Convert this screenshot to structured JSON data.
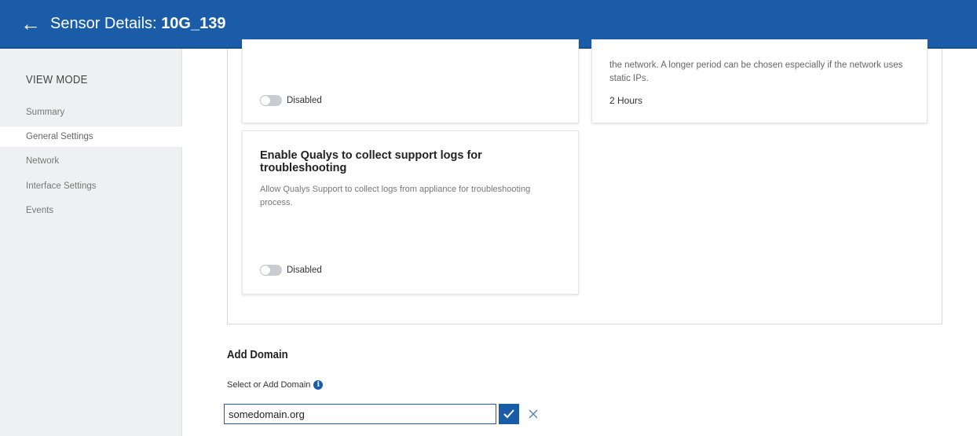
{
  "header": {
    "back_icon": "arrow-left-icon",
    "title_prefix": "Sensor Details:",
    "sensor_name": "10G_139"
  },
  "sidebar": {
    "mode_label": "VIEW MODE",
    "items": [
      {
        "label": "Summary"
      },
      {
        "label": "General Settings",
        "active": true
      },
      {
        "label": "Network"
      },
      {
        "label": "Interface Settings"
      },
      {
        "label": "Events"
      }
    ]
  },
  "cards": {
    "card1": {
      "toggle_label": "Disabled"
    },
    "card2": {
      "description": "the network. A longer period can be chosen especially if the network uses static IPs.",
      "value": "2 Hours"
    },
    "card3": {
      "heading": "Enable Qualys to collect support logs for troubleshooting",
      "description": "Allow Qualys Support to collect logs from appliance for troubleshooting process.",
      "toggle_label": "Disabled"
    }
  },
  "domain": {
    "section_title": "Add Domain",
    "field_label": "Select or Add Domain",
    "info_icon": "info-icon",
    "value": "somedomain.org",
    "confirm_icon": "check-icon",
    "cancel_icon": "close-icon"
  },
  "colors": {
    "brand": "#1a5ca8",
    "sidebar_bg": "#eef0f3"
  }
}
